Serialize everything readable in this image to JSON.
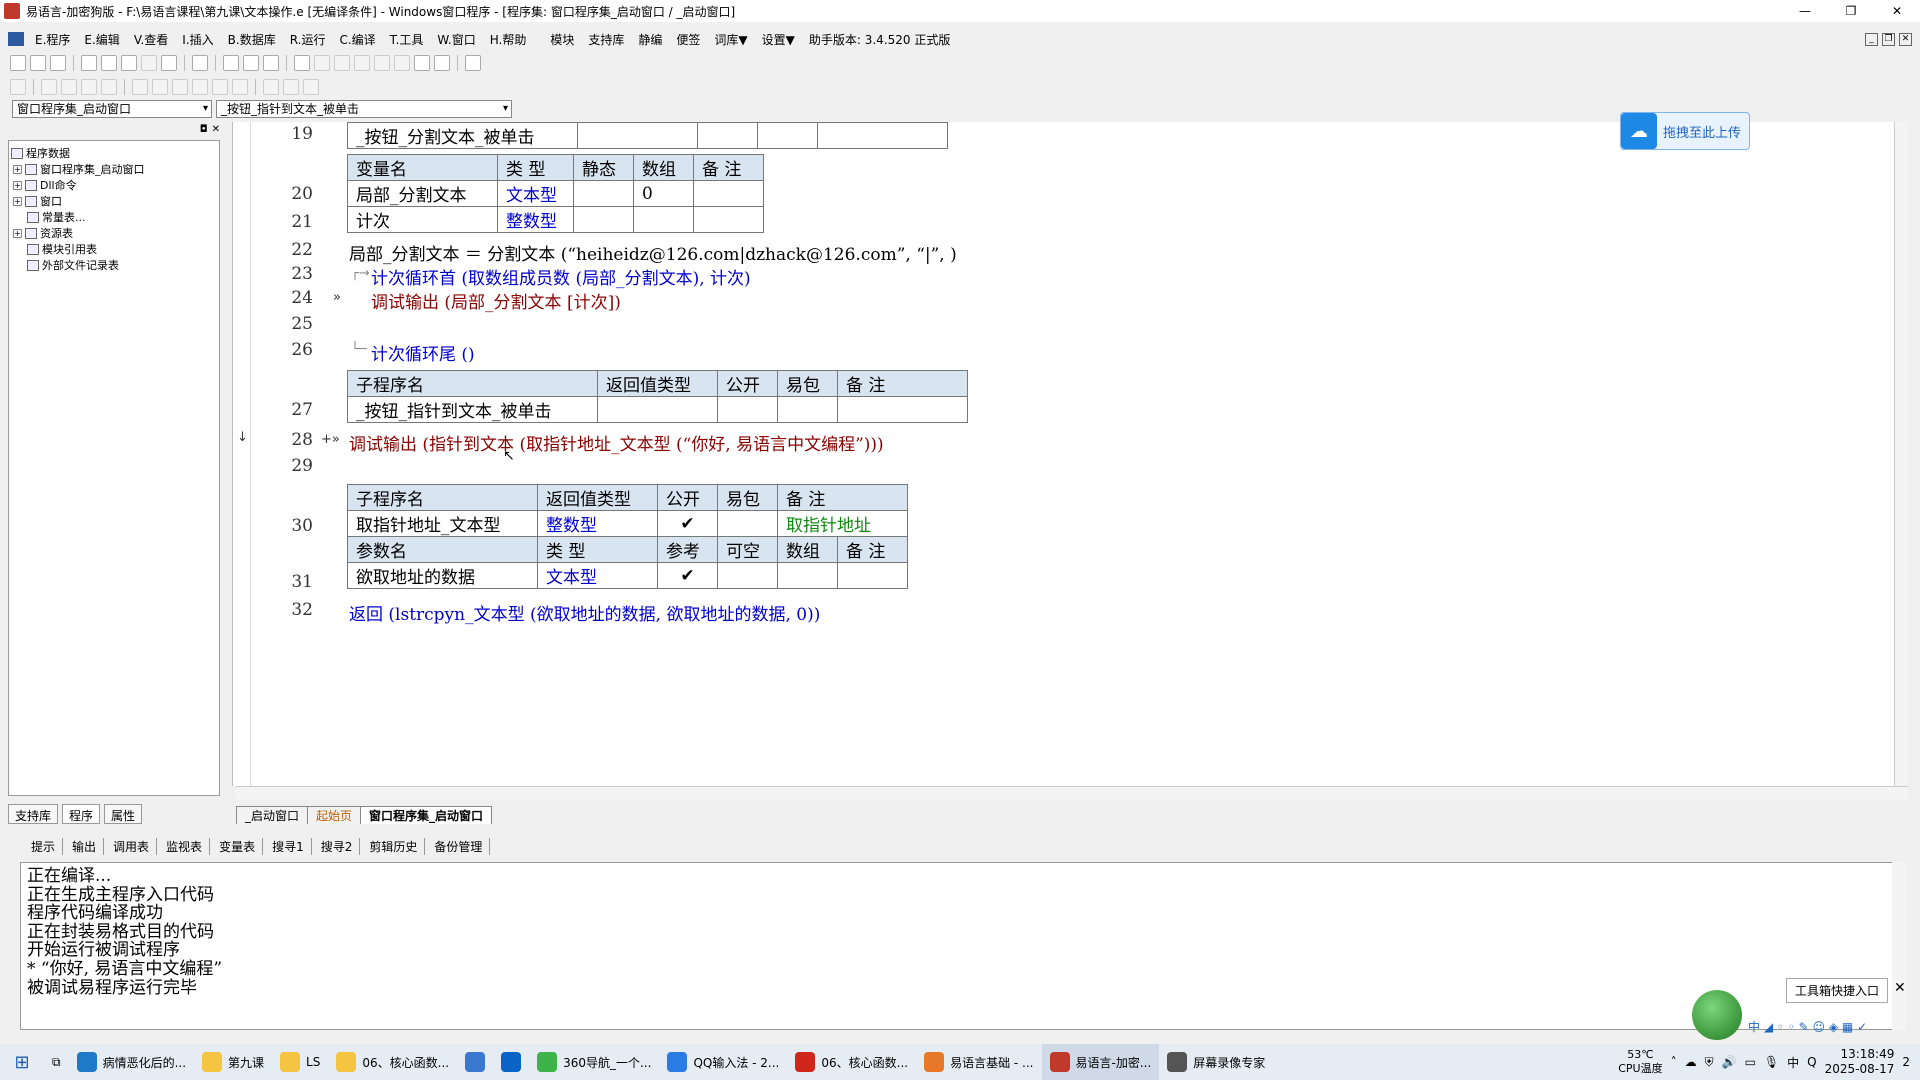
{
  "window": {
    "title": "易语言-加密狗版 - F:\\易语言课程\\第九课\\文本操作.e [无编译条件] - Windows窗口程序 - [程序集: 窗口程序集_启动窗口 / _启动窗口]",
    "min": "—",
    "max": "❐",
    "close": "✕"
  },
  "menu": {
    "items": [
      "E.程序",
      "E.编辑",
      "V.查看",
      "I.插入",
      "B.数据库",
      "R.运行",
      "C.编译",
      "T.工具",
      "W.窗口",
      "H.帮助",
      "模块",
      "支持库",
      "静编",
      "便签",
      "词库▼",
      "设置▼",
      "助手版本: 3.4.520 正式版"
    ]
  },
  "combos": {
    "assembly": "窗口程序集_启动窗口",
    "method": "_按钮_指针到文本_被单击"
  },
  "tree": {
    "root": "程序数据",
    "items": [
      "窗口程序集_启动窗口",
      "Dll命令",
      "窗口",
      "常量表...",
      "资源表",
      "模块引用表",
      "外部文件记录表"
    ]
  },
  "sidetabs": [
    "支持库",
    "程序",
    "属性"
  ],
  "upload": {
    "label": "拖拽至此上传",
    "icon": "cloud-icon"
  },
  "code": {
    "line_numbers": [
      "19",
      "20",
      "21",
      "22",
      "23",
      "24",
      "25",
      "26",
      "27",
      "28",
      "29",
      "30",
      "31",
      "32"
    ],
    "tbl19": "_按钮_分割文本_被单击",
    "var_header": [
      "变量名",
      "类 型",
      "静态",
      "数组",
      "备 注"
    ],
    "var_rows": [
      [
        "局部_分割文本",
        "文本型",
        "",
        "0",
        ""
      ],
      [
        "计次",
        "整数型",
        "",
        "",
        ""
      ]
    ],
    "l22": "局部_分割文本 ＝ 分割文本 (“heiheidz@126.com|dzhack@126.com”, “|”, )",
    "l23": "计次循环首 (取数组成员数 (局部_分割文本), 计次)",
    "l24": "调试输出 (局部_分割文本 [计次])",
    "l26": "计次循环尾 ()",
    "sub_header": [
      "子程序名",
      "返回值类型",
      "公开",
      "易包",
      "备 注"
    ],
    "sub27": [
      "_按钮_指针到文本_被单击",
      "",
      "",
      "",
      ""
    ],
    "l28": "调试输出 (指针到文本 (取指针地址_文本型 (“你好, 易语言中文编程”)))",
    "sub30_header": [
      "子程序名",
      "返回值类型",
      "公开",
      "易包",
      "备 注"
    ],
    "sub30": [
      "取指针地址_文本型",
      "整数型",
      "✔",
      "",
      "取指针地址"
    ],
    "param_header": [
      "参数名",
      "类 型",
      "参考",
      "可空",
      "数组",
      "备 注"
    ],
    "param31": [
      "欲取地址的数据",
      "文本型",
      "✔",
      "",
      "",
      ""
    ],
    "l32": "返回 (lstrcpyn_文本型 (欲取地址的数据, 欲取地址的数据, 0))"
  },
  "doctabs": [
    "_启动窗口",
    "起始页",
    "窗口程序集_启动窗口"
  ],
  "outtabs": [
    "提示",
    "输出",
    "调用表",
    "监视表",
    "变量表",
    "搜寻1",
    "搜寻2",
    "剪辑历史",
    "备份管理"
  ],
  "output": [
    "正在编译...",
    "正在生成主程序入口代码",
    "程序代码编译成功",
    "正在封装易格式目的代码",
    "开始运行被调试程序",
    "* “你好, 易语言中文编程”",
    "被调试易程序运行完毕"
  ],
  "toolbox": {
    "label": "工具箱快捷入口",
    "close": "✕"
  },
  "tray_icons": "中 ◢ ◦ ◦ ✎ ☺ ◈ ▦ ✓",
  "taskbar": {
    "items": [
      "病情恶化后的...",
      "第九课",
      "LS",
      "06、核心函数...",
      "",
      "",
      "360导航_一个...",
      "QQ输入法 - 2...",
      "06、核心函数...",
      "易语言基础 - ...",
      "易语言-加密...",
      "屏幕录像专家"
    ],
    "temp": "53℃",
    "cpu": "CPU温度",
    "time": "13:18:49",
    "date": "2025-08-17",
    "notif": "2"
  }
}
